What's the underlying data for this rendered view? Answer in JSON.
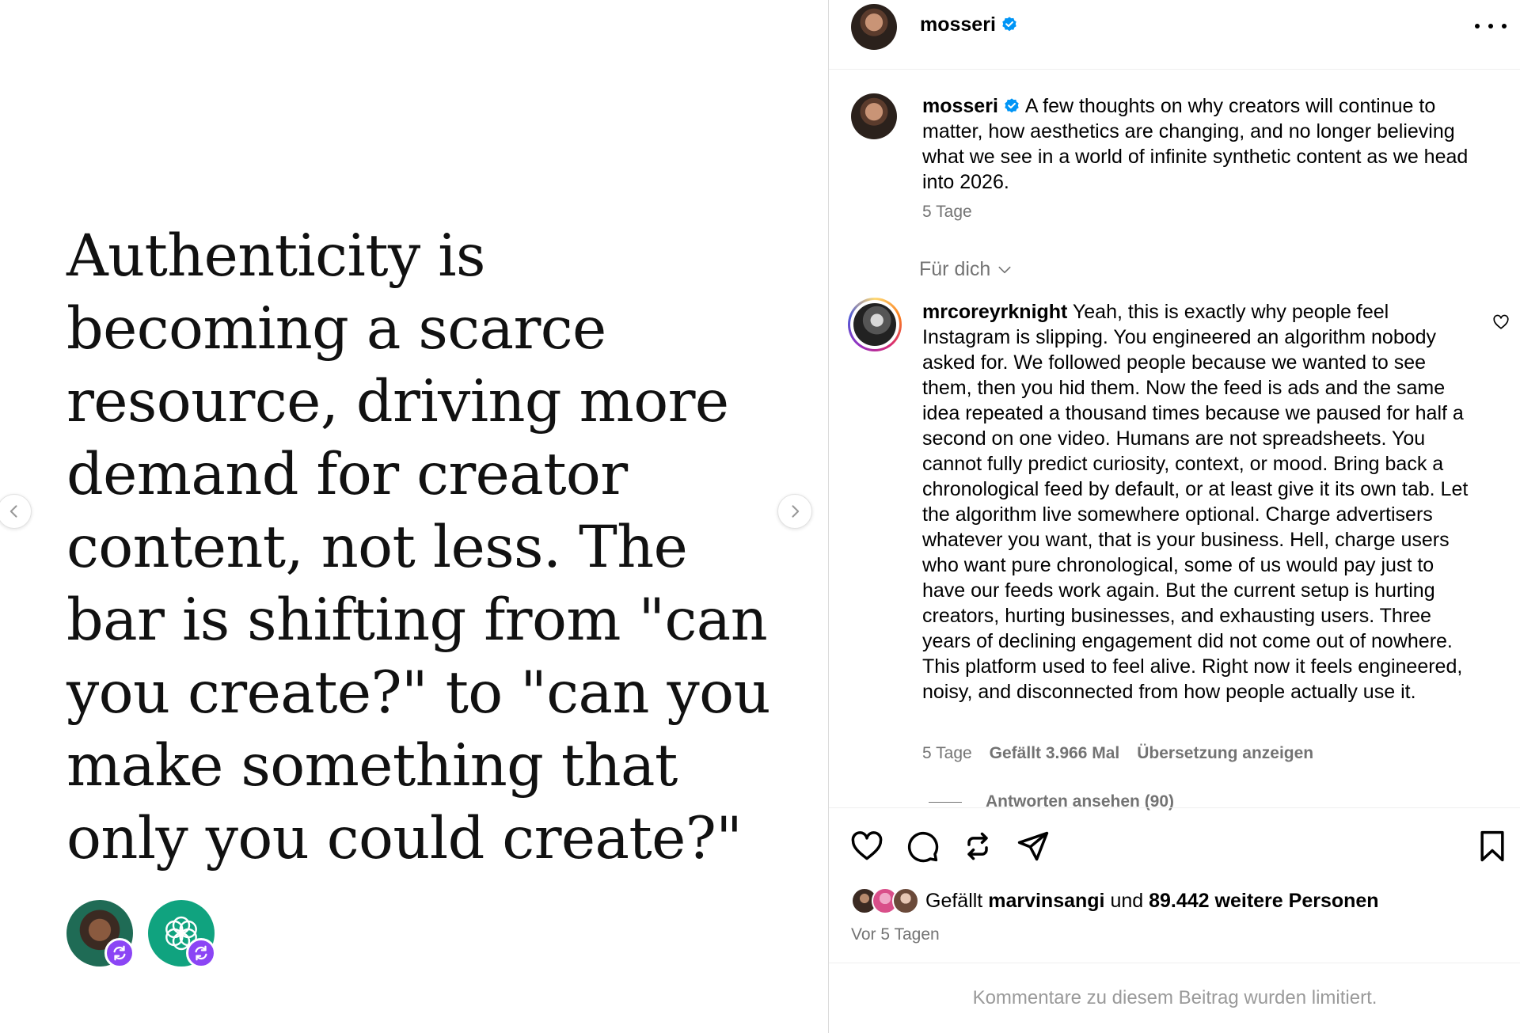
{
  "post": {
    "quote": "Authenticity is becoming a scarce resource, driving more demand for creator content, not less. The bar is shifting from \"can you create?\" to \"can you make something that only you could create?\""
  },
  "header": {
    "username": "mosseri"
  },
  "caption": {
    "username": "mosseri",
    "text": "A few thoughts on why creators will continue to matter, how aesthetics are changing, and no longer believing what we see in a world of infinite synthetic content as we head into 2026.",
    "time": "5 Tage"
  },
  "filter": {
    "label": "Für dich"
  },
  "comment": {
    "username": "mrcoreyrknight",
    "text": "Yeah, this is exactly why people feel Instagram is slipping. You engineered an algorithm nobody asked for. We followed people because we wanted to see them, then you hid them. Now the feed is ads and the same idea repeated a thousand times because we paused for half a second on one video. Humans are not spreadsheets. You cannot fully predict curiosity, context, or mood. Bring back a chronological feed by default, or at least give it its own tab. Let the algorithm live somewhere optional. Charge advertisers whatever you want, that is your business. Hell, charge users who want pure chronological, some of us would pay just to have our feeds work again. But the current setup is hurting creators, hurting businesses, and exhausting users. Three years of declining engagement did not come out of nowhere. This platform used to feel alive. Right now it feels engineered, noisy, and disconnected from how people actually use it.",
    "time": "5 Tage",
    "likes": "Gefällt 3.966 Mal",
    "translate": "Übersetzung anzeigen",
    "replies": "Antworten ansehen (90)"
  },
  "likes": {
    "prefix": "Gefällt",
    "user": "marvinsangi",
    "connector": "und",
    "others": "89.442 weitere Personen"
  },
  "posted": "Vor 5 Tagen",
  "limited_notice": "Kommentare zu diesem Beitrag wurden limitiert.",
  "colors": {
    "verified": "#0095f6",
    "secondary_text": "#737373",
    "collab_badge": "#8b45f5",
    "openai_green": "#10a37f"
  },
  "icons": [
    "chevron-left-icon",
    "chevron-right-icon",
    "verified-icon",
    "more-icon",
    "chevron-down-icon",
    "heart-icon",
    "comment-icon",
    "repost-icon",
    "share-icon",
    "bookmark-icon",
    "collab-icon"
  ]
}
